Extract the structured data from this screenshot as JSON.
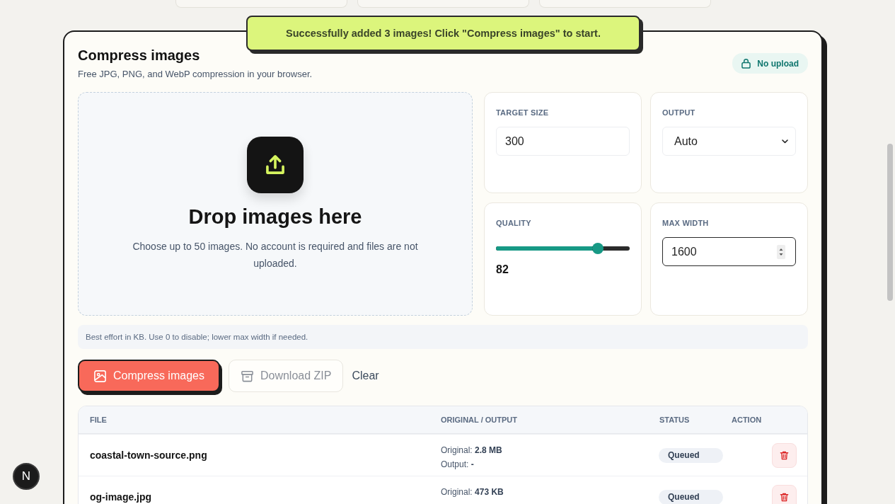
{
  "toast": {
    "message": "Successfully added 3 images! Click \"Compress images\" to start."
  },
  "header": {
    "title": "Compress images",
    "subtitle": "Free JPG, PNG, and WebP compression in your browser.",
    "badge": "No upload"
  },
  "dropzone": {
    "title": "Drop images here",
    "description": "Choose up to 50 images. No account is required and files are not uploaded."
  },
  "settings": [
    {
      "kind": "input",
      "label": "TARGET SIZE",
      "value": "300",
      "focused": false
    },
    {
      "kind": "select",
      "label": "OUTPUT",
      "value": "Auto",
      "focused": false
    },
    {
      "kind": "slider",
      "label": "QUALITY",
      "level": 0.76,
      "reading": "82"
    },
    {
      "kind": "number",
      "label": "MAX WIDTH",
      "value": "1600",
      "focused": true
    }
  ],
  "hint": "Best effort in KB. Use 0 to disable; lower max width if needed.",
  "actions": [
    {
      "kind": "primary",
      "label": "Compress images",
      "disabled": false
    },
    {
      "kind": "secondary",
      "label": "Download ZIP",
      "disabled": true
    },
    {
      "kind": "link",
      "label": "Clear",
      "disabled": false
    }
  ],
  "table": {
    "columns": [
      "FILE",
      "ORIGINAL / OUTPUT",
      "STATUS",
      "ACTION"
    ],
    "rows": [
      {
        "file": "coastal-town-source.png",
        "original": "Original: **2.8 MB**",
        "output": "Output: **-**",
        "status": "Queued"
      },
      {
        "file": "og-image.jpg",
        "original": "Original: **473 KB**",
        "status": "Queued"
      }
    ]
  },
  "dev_badge": {
    "label": "N"
  }
}
